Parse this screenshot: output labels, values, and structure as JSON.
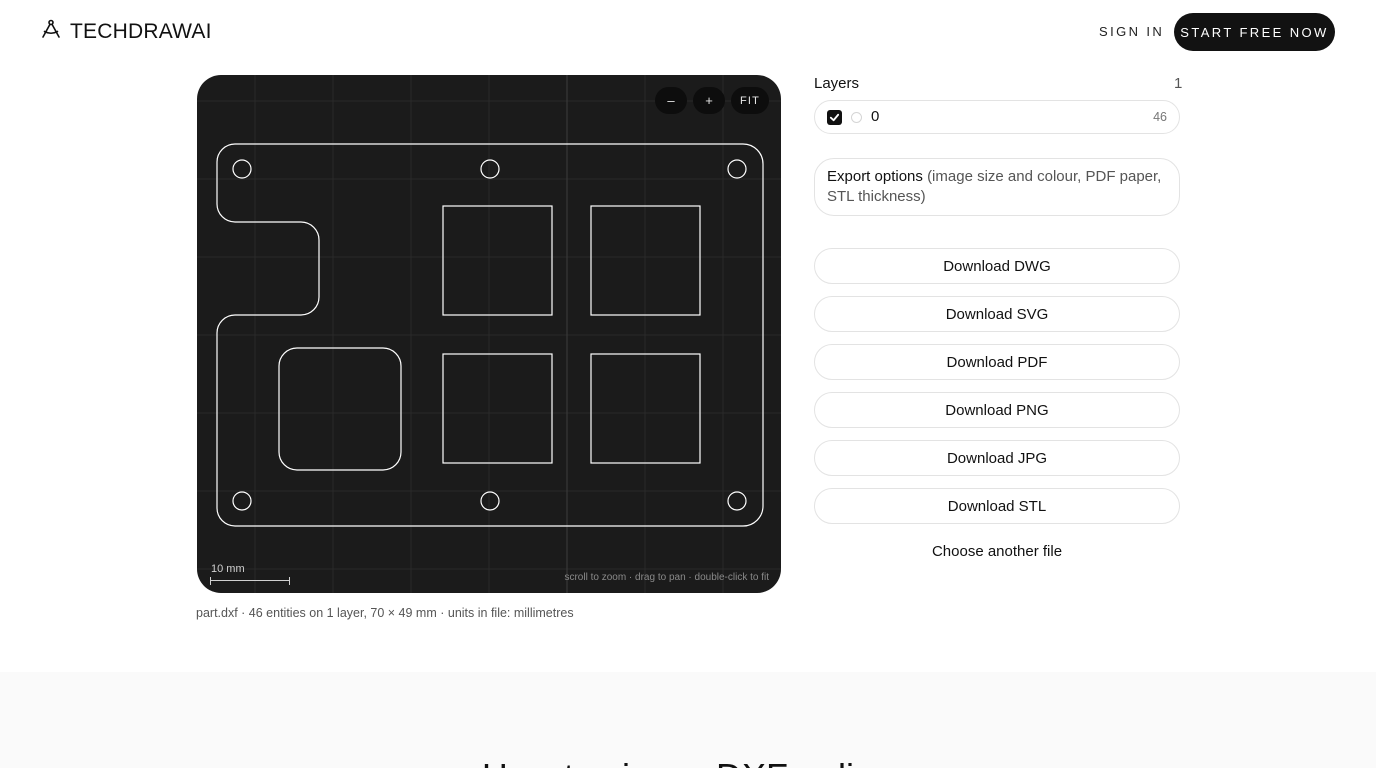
{
  "header": {
    "logo_text": "TECHDRAWAI",
    "signin_label": "SIGN IN",
    "cta_label": "START FREE NOW"
  },
  "viewer": {
    "zoom_out_label": "–",
    "zoom_in_label": "+",
    "fit_label": "FIT",
    "scale_label": "10 mm",
    "hint": "scroll to zoom · drag to pan · double-click to fit",
    "background_color": "#1b1b1b",
    "stroke_color": "#ffffff"
  },
  "file_info": "part.dxf · 46 entities on 1 layer, 70 × 49 mm · units in file: millimetres",
  "layers": {
    "title": "Layers",
    "count": "1",
    "items": [
      {
        "name": "0",
        "entities": "46",
        "visible": true
      }
    ]
  },
  "export_options": {
    "label": "Export options",
    "detail": "(image size and colour, PDF paper, STL thickness)"
  },
  "downloads": [
    "Download DWG",
    "Download SVG",
    "Download PDF",
    "Download PNG",
    "Download JPG",
    "Download STL"
  ],
  "choose_file_label": "Choose another file",
  "section_title": "How to view a DXF online"
}
